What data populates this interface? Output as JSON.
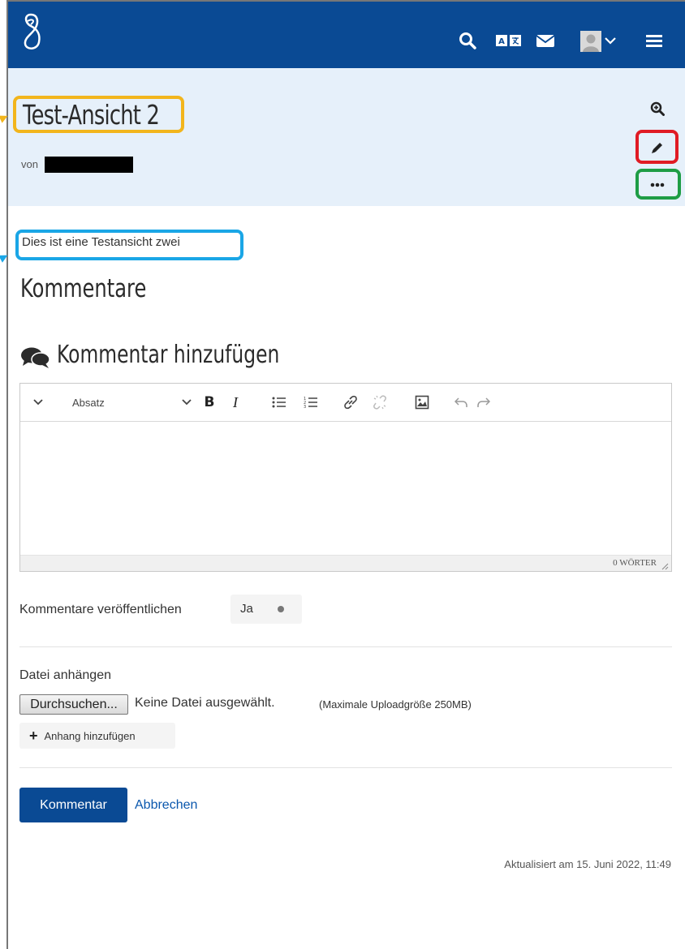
{
  "header": {
    "icons": [
      "logo-icon",
      "search-icon",
      "language-icon",
      "mail-icon",
      "user-avatar-icon",
      "chevron-down-icon",
      "menu-icon"
    ]
  },
  "view": {
    "title": "Test-Ansicht 2",
    "by_label": "von",
    "description": "Dies ist eine Testansicht zwei",
    "side_actions": [
      "zoom-icon",
      "edit-pencil-icon",
      "more-options-icon"
    ]
  },
  "comments": {
    "heading": "Kommentare",
    "add_heading": "Kommentar hinzufügen",
    "editor": {
      "paragraph_format": "Absatz",
      "toolbar_icons": [
        "toolbar-toggle-icon",
        "paragraph-dropdown-icon",
        "bold-icon",
        "italic-icon",
        "bullet-list-icon",
        "numbered-list-icon",
        "link-icon",
        "unlink-icon",
        "image-icon",
        "undo-icon",
        "redo-icon"
      ],
      "bold_glyph": "B",
      "italic_glyph": "I",
      "word_count": "0 WÖRTER"
    },
    "publish": {
      "label": "Kommentare veröffentlichen",
      "value": "Ja"
    },
    "attachment": {
      "label": "Datei anhängen",
      "browse_label": "Durchsuchen...",
      "no_file_text": "Keine Datei ausgewählt.",
      "max_size_text": "(Maximale Uploadgröße 250MB)",
      "add_label": "Anhang hinzufügen"
    },
    "submit_label": "Kommentar",
    "cancel_label": "Abbrechen"
  },
  "footer": {
    "updated_text": "Aktualisiert am 15. Juni 2022, 11:49"
  },
  "colors": {
    "brand_blue": "#0a4a94",
    "title_band": "#e6f0fa",
    "highlight_orange": "#f2b51c",
    "highlight_red": "#e01b24",
    "highlight_green": "#1e9d45",
    "highlight_blue": "#1aa6e6"
  }
}
